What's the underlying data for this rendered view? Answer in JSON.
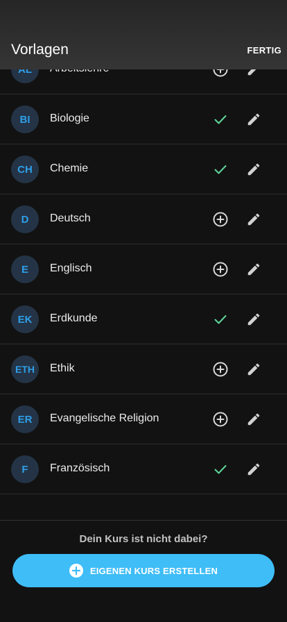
{
  "header": {
    "title": "Vorlagen",
    "done_label": "FERTIG"
  },
  "courses": [
    {
      "abbr": "AL",
      "name": "Arbeitslehre",
      "status": "add"
    },
    {
      "abbr": "BI",
      "name": "Biologie",
      "status": "added"
    },
    {
      "abbr": "CH",
      "name": "Chemie",
      "status": "added"
    },
    {
      "abbr": "D",
      "name": "Deutsch",
      "status": "add"
    },
    {
      "abbr": "E",
      "name": "Englisch",
      "status": "add"
    },
    {
      "abbr": "EK",
      "name": "Erdkunde",
      "status": "added"
    },
    {
      "abbr": "ETH",
      "name": "Ethik",
      "status": "add"
    },
    {
      "abbr": "ER",
      "name": "Evangelische Religion",
      "status": "add"
    },
    {
      "abbr": "F",
      "name": "Französisch",
      "status": "added"
    }
  ],
  "icons": {
    "add": "add-circle-icon",
    "added": "check-icon",
    "edit": "pencil-icon",
    "create": "plus-circle-icon"
  },
  "colors": {
    "accent": "#3ebdf7",
    "avatar_bg": "#243446",
    "avatar_text": "#2f9ee8",
    "check": "#5fd79a"
  },
  "footer": {
    "prompt": "Dein Kurs ist nicht dabei?",
    "button_label": "EIGENEN KURS ERSTELLEN"
  }
}
